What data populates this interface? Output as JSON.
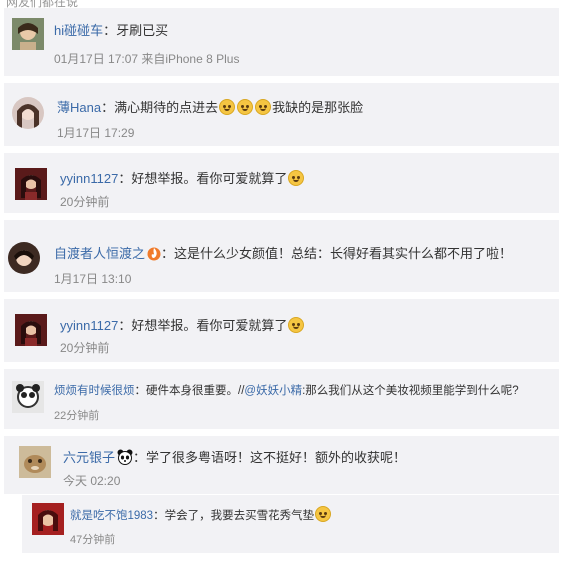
{
  "top_clipped_text": "网友们都在说",
  "comments": [
    {
      "name": "hi碰碰车",
      "sep": "：",
      "text": "牙刷已买",
      "meta": "01月17日 17:07 来自iPhone 8 Plus"
    },
    {
      "name": "薄Hana",
      "sep": "：",
      "text": "满心期待的点进去",
      "text_after": "我缺的是那张脸",
      "meta": "1月17日 17:29",
      "icons": [
        "crying-emoji-icon",
        "crying-emoji-icon",
        "crying-emoji-icon"
      ]
    },
    {
      "name": "yyinn1127",
      "sep": "：",
      "text": "好想举报。看你可爱就算了",
      "meta": "20分钟前",
      "icons": [
        "crying-emoji-icon"
      ]
    },
    {
      "name": "自渡者人恒渡之",
      "sep": "：",
      "text": "这是什么少女颜值！总结：长得好看其实什么都不用了啦！",
      "meta": "1月17日 13:10",
      "icons": [
        "fire-badge-icon"
      ]
    },
    {
      "name": "yyinn1127",
      "sep": "：",
      "text": "好想举报。看你可爱就算了",
      "meta": "20分钟前",
      "icons": [
        "crying-emoji-icon"
      ]
    },
    {
      "name": "烦烦有时候很烦",
      "sep": "：",
      "text": "硬件本身很重要。//",
      "mention": "@妖妖小精",
      "text_after": ":那么我们从这个美妆视频里能学到什么呢?",
      "meta": "22分钟前"
    },
    {
      "name": "六元银子",
      "sep": "：",
      "text": "学了很多粤语呀！这不挺好！额外的收获呢！",
      "meta": "今天 02:20",
      "icons": [
        "panda-icon"
      ]
    },
    {
      "name": "就是吃不饱1983",
      "sep": "：",
      "text": "学会了，我要去买雪花秀气垫",
      "meta": "47分钟前",
      "icons": [
        "laughing-emoji-icon"
      ]
    }
  ]
}
